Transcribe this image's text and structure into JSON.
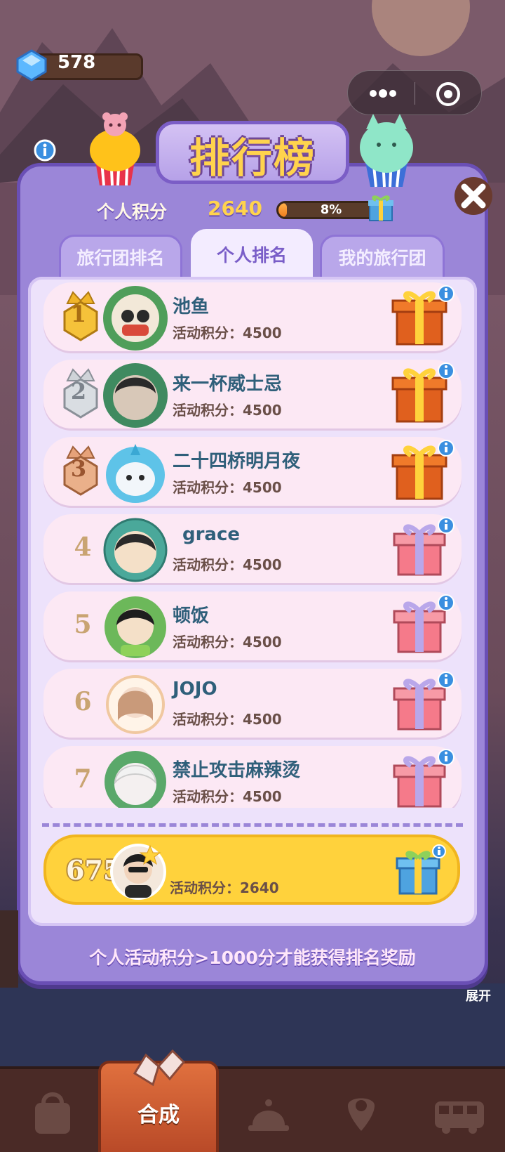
{
  "gem": {
    "count": "578"
  },
  "panel": {
    "title": "排行榜",
    "personal_score_label": "个人积分",
    "personal_score_value": "2640",
    "progress_text": "8%",
    "progress_fraction": 0.08
  },
  "tabs": [
    {
      "label": "旅行团排名",
      "active": false
    },
    {
      "label": "个人排名",
      "active": true
    },
    {
      "label": "我的旅行团",
      "active": false
    }
  ],
  "rows": [
    {
      "rank": "1",
      "name": "池鱼",
      "score": "活动积分：4500",
      "medal": "gold"
    },
    {
      "rank": "2",
      "name": "来一杯威士忌",
      "score": "活动积分：4500",
      "medal": "silver"
    },
    {
      "rank": "3",
      "name": "二十四桥明月夜",
      "score": "活动积分：4500",
      "medal": "bronze"
    },
    {
      "rank": "4",
      "name": "grace",
      "score": "活动积分：4500"
    },
    {
      "rank": "5",
      "name": "顿饭",
      "score": "活动积分：4500"
    },
    {
      "rank": "6",
      "name": "JOJO",
      "score": "活动积分：4500"
    },
    {
      "rank": "7",
      "name": "禁止攻击麻辣烫",
      "score": "活动积分：4500"
    }
  ],
  "my_row": {
    "rank": "6755",
    "score": "活动积分：2640"
  },
  "footer_note": "个人活动积分>1000分才能获得排名奖励",
  "background": {
    "expand_label": "展开"
  },
  "nav": {
    "active_label": "合成"
  },
  "colors": {
    "panel": "#9b86d8",
    "panel_border": "#6a4fb5",
    "title": "#ffd34d",
    "my_row": "#ffd23c",
    "name": "#2f5f7a"
  }
}
